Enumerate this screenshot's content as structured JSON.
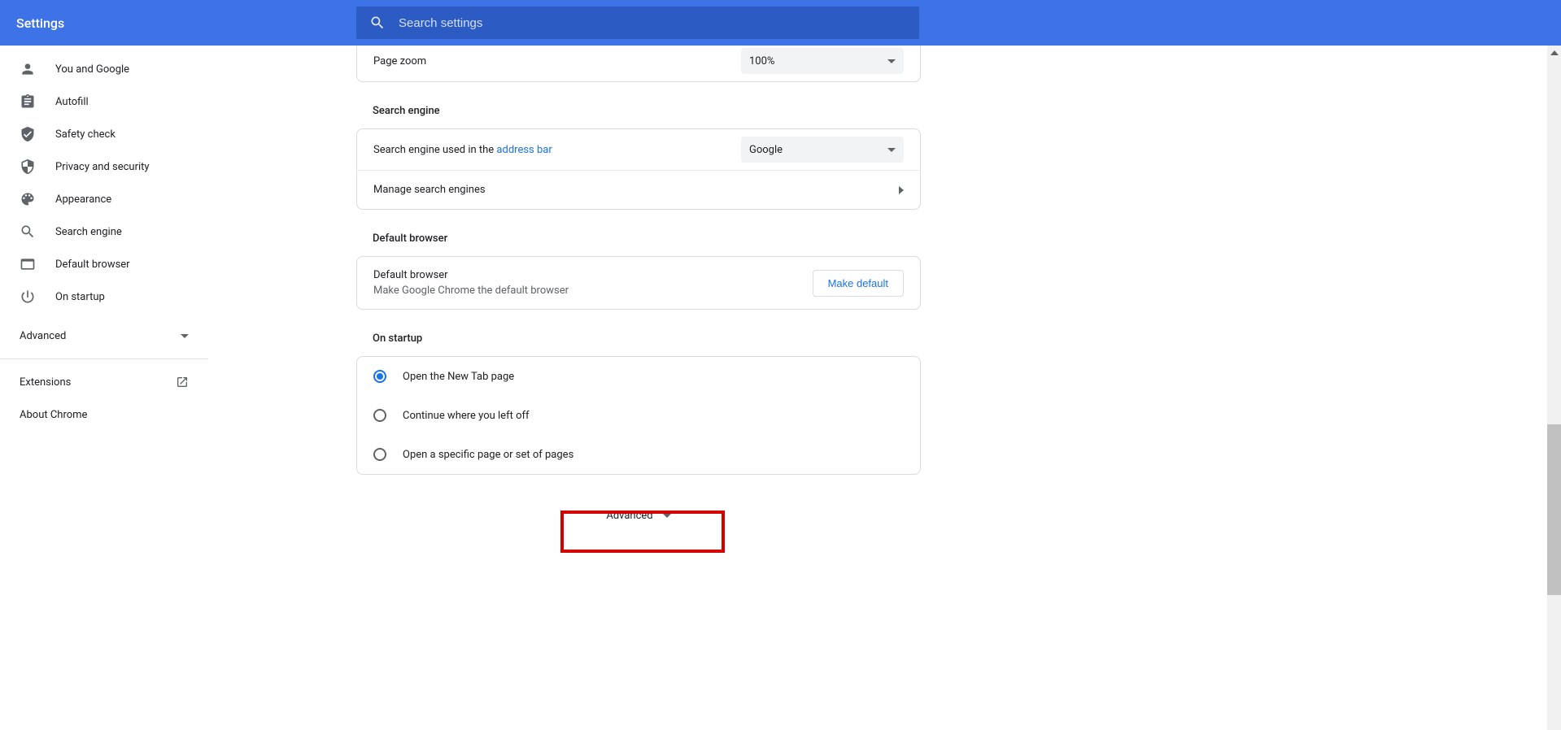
{
  "header": {
    "title": "Settings",
    "search_placeholder": "Search settings"
  },
  "sidebar": {
    "items": [
      {
        "label": "You and Google"
      },
      {
        "label": "Autofill"
      },
      {
        "label": "Safety check"
      },
      {
        "label": "Privacy and security"
      },
      {
        "label": "Appearance"
      },
      {
        "label": "Search engine"
      },
      {
        "label": "Default browser"
      },
      {
        "label": "On startup"
      }
    ],
    "advanced": "Advanced",
    "extensions": "Extensions",
    "about": "About Chrome"
  },
  "page_zoom": {
    "label": "Page zoom",
    "value": "100%"
  },
  "search_engine": {
    "title": "Search engine",
    "row1_prefix": "Search engine used in the ",
    "row1_link": "address bar",
    "value": "Google",
    "manage": "Manage search engines"
  },
  "default_browser": {
    "title": "Default browser",
    "label": "Default browser",
    "sub": "Make Google Chrome the default browser",
    "button": "Make default"
  },
  "on_startup": {
    "title": "On startup",
    "opt1": "Open the New Tab page",
    "opt2": "Continue where you left off",
    "opt3": "Open a specific page or set of pages"
  },
  "advanced_toggle": "Advanced"
}
